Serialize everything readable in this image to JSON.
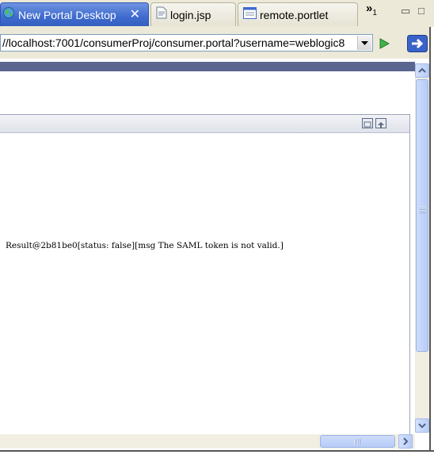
{
  "tabs": [
    {
      "label": "New Portal Desktop",
      "icon": "globe-icon",
      "active": true
    },
    {
      "label": "login.jsp",
      "icon": "jsp-file-icon",
      "active": false
    },
    {
      "label": "remote.portlet",
      "icon": "portlet-file-icon",
      "active": false
    }
  ],
  "tab_overflow": {
    "symbol": "»",
    "count": "1"
  },
  "window_controls": {
    "minimize": "▭",
    "maximize": "□"
  },
  "address": {
    "url": "//localhost:7001/consumerProj/consumer.portal?username=weblogic8"
  },
  "content": {
    "message": "Result@2b81be0[status: false][msg The SAML token is not valid.]"
  },
  "colors": {
    "active_tab": "#3f6bcf",
    "header_strip": "#5b6690",
    "scrollbar": "#b9cdf7"
  }
}
